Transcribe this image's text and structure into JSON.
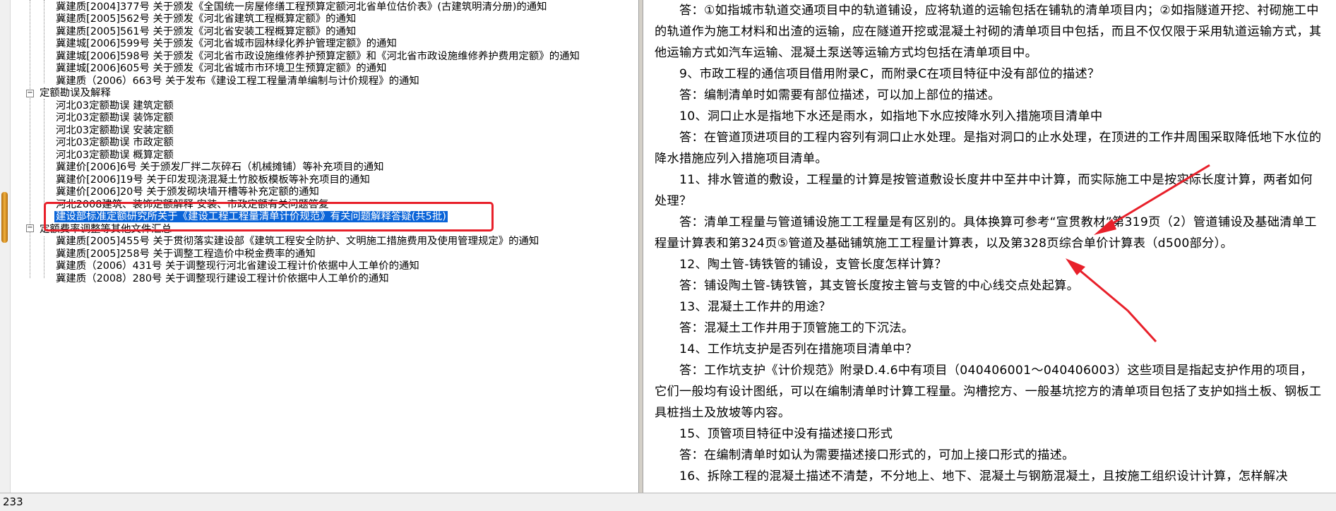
{
  "tree": {
    "items": [
      {
        "label": "冀建质[2004]377号 关于颁发《全国统一房屋修缮工程预算定额河北省单位估价表》(古建筑明清分册)的通知"
      },
      {
        "label": "冀建质[2005]562号 关于颁发《河北省建筑工程概算定额》的通知"
      },
      {
        "label": "冀建质[2005]561号 关于颁发《河北省安装工程概算定额》的通知"
      },
      {
        "label": "冀建城[2006]599号 关于颁发《河北省城市园林绿化养护管理定额》的通知"
      },
      {
        "label": "冀建城[2006]598号 关于颁发《河北省市政设施维修养护预算定额》和《河北省市政设施维修养护费用定额》的通知"
      },
      {
        "label": "冀建城[2006]605号 关于颁发《河北省城市市环境卫生预算定额》的通知"
      },
      {
        "label": "冀建质（2006）663号 关于发布《建设工程工程量清单编制与计价规程》的通知"
      },
      {
        "label": "定额勘误及解释"
      },
      {
        "label": "河北03定额勘误 建筑定额"
      },
      {
        "label": "河北03定额勘误 装饰定额"
      },
      {
        "label": "河北03定额勘误 安装定额"
      },
      {
        "label": "河北03定额勘误 市政定额"
      },
      {
        "label": "河北03定额勘误 概算定额"
      },
      {
        "label": "冀建价[2006]6号 关于颁发厂拌二灰碎石（机械摊铺）等补充项目的通知"
      },
      {
        "label": "冀建价[2006]19号 关于印发现浇混凝土竹胶板模板等补充项目的通知"
      },
      {
        "label": "冀建价[2006]20号 关于颁发砌块墙开槽等补充定额的通知"
      },
      {
        "label": "河北2008建筑、装饰定额解释 安装、市政定额有关问题答复"
      },
      {
        "label": "建设部标准定额研究所关于《建设工程工程量清单计价规范》有关问题解释答疑(共5批)"
      },
      {
        "label": "定额费率调整等其他文件汇总"
      },
      {
        "label": "冀建质[2005]455号 关于贯彻落实建设部《建筑工程安全防护、文明施工措施费用及使用管理规定》的通知"
      },
      {
        "label": "冀建质[2005]258号 关于调整工程造价中税金费率的通知"
      },
      {
        "label": "冀建质（2006）431号 关于调整现行河北省建设工程计价依据中人工单价的通知"
      },
      {
        "label": "冀建质（2008）280号 关于调整现行建设工程计价依据中人工单价的通知"
      }
    ]
  },
  "document": {
    "paragraphs": [
      "　　答：①如指城市轨道交通项目中的轨道铺设，应将轨道的运输包括在铺轨的清单项目内；②如指隧道开挖、衬砌施工中的轨道作为施工材料和出渣的运输，应在隧道开挖或混凝土衬砌的清单项目中包括，而且不仅仅限于采用轨道运输方式，其他运输方式如汽车运输、混凝土泵送等运输方式均包括在清单项目中。",
      "　　9、市政工程的通信项目借用附录C，而附录C在项目特征中没有部位的描述？",
      "　　答：编制清单时如需要有部位描述，可以加上部位的描述。",
      "　　10、洞口止水是指地下水还是雨水，如指地下水应按降水列入措施项目清单中",
      "　　答：在管道顶进项目的工程内容列有洞口止水处理。是指对洞口的止水处理，在顶进的工作井周围采取降低地下水位的降水措施应列入措施项目清单。",
      "　　11、排水管道的敷设，工程量的计算是按管道敷设长度井中至井中计算，而实际施工中是按实际长度计算，两者如何处理？",
      "　　答：清单工程量与管道铺设施工工程量是有区别的。具体换算可参考“宣贯教材”第319页（2）管道铺设及基础清单工程量计算表和第324页⑤管道及基础铺筑施工工程量计算表，以及第328页综合单价计算表（d500部分）。",
      "　　12、陶土管-铸铁管的铺设，支管长度怎样计算？",
      "　　答：铺设陶土管-铸铁管，其支管长度按主管与支管的中心线交点处起算。",
      "　　13、混凝土工作井的用途？",
      "　　答：混凝土工作井用于顶管施工的下沉法。",
      "　　14、工作坑支护是否列在措施项目清单中？",
      "　　答：工作坑支护《计价规范》附录D.4.6中有项目（040406001～040406003）这些项目是指起支护作用的项目，它们一般均有设计图纸，可以在编制清单时计算工程量。沟槽挖方、一般基坑挖方的清单项目包括了支护如挡土板、钢板工具桩挡土及放坡等内容。",
      "　　15、顶管项目特征中没有描述接口形式",
      "　　答：在编制清单时如认为需要描述接口形式的，可加上接口形式的描述。",
      "　　16、拆除工程的混凝土描述不清楚，不分地上、地下、混凝土与钢筋混凝土，且按施工组织设计计算，怎样解决"
    ]
  },
  "status_bar": {
    "text": "233"
  },
  "colors": {
    "selection": "#0a64d8",
    "annotation": "#e8202a"
  }
}
